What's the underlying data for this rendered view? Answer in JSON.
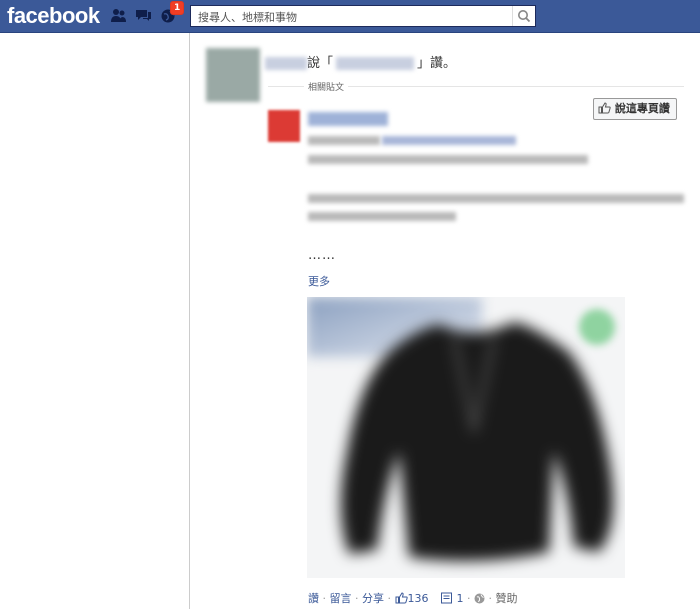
{
  "header": {
    "logo": "facebook",
    "notification_count": "1",
    "search_placeholder": "搜尋人、地標和事物"
  },
  "story": {
    "said_prefix": "說「",
    "said_suffix": "」讚。",
    "related_label": "相關貼文"
  },
  "post": {
    "like_page_label": "說這專頁讚",
    "ellipsis": "……",
    "more_label": "更多"
  },
  "footer": {
    "like": "讚",
    "comment": "留言",
    "share": "分享",
    "like_count": "136",
    "comment_count": "1",
    "sponsored": "贊助",
    "separator": "·"
  },
  "colors": {
    "brand": "#3b5998",
    "badge": "#f03d25",
    "link": "#3b5998"
  }
}
